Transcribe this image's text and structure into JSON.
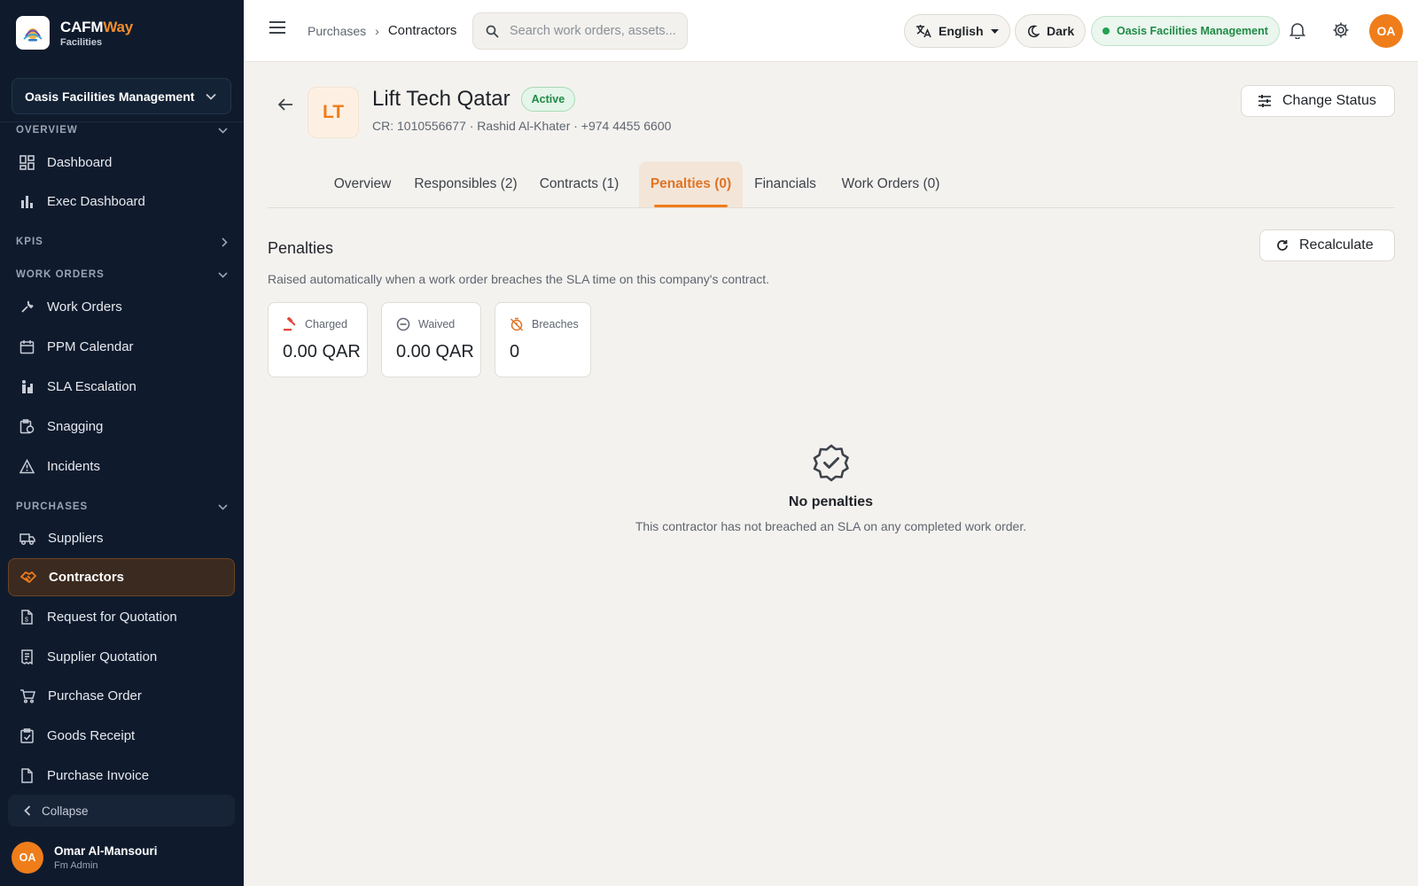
{
  "brand": {
    "name_primary": "CAFM",
    "name_accent": "Way",
    "subtitle": "Facilities",
    "accent_color": "#f08c2e"
  },
  "sidebar": {
    "org_selector": {
      "value": "Oasis Facilities Management"
    },
    "sections": {
      "overview": "OVERVIEW",
      "kpis": "KPIS",
      "work_orders": "WORK ORDERS",
      "purchases": "PURCHASES"
    },
    "items": {
      "dashboard": "Dashboard",
      "exec_dashboard": "Exec Dashboard",
      "work_orders": "Work Orders",
      "ppm_calendar": "PPM Calendar",
      "sla_escalation": "SLA Escalation",
      "snagging": "Snagging",
      "incidents": "Incidents",
      "suppliers": "Suppliers",
      "contractors": "Contractors",
      "rfq": "Request for Quotation",
      "supplier_quotation": "Supplier Quotation",
      "purchase_order": "Purchase Order",
      "goods_receipt": "Goods Receipt",
      "purchase_invoice": "Purchase Invoice"
    },
    "active_item": "Contractors",
    "collapse_label": "Collapse",
    "user": {
      "initials": "OA",
      "name": "Omar Al-Mansouri",
      "role": "Fm Admin"
    }
  },
  "topbar": {
    "breadcrumb": {
      "parent": "Purchases",
      "separator": "›",
      "current": "Contractors"
    },
    "search": {
      "placeholder": "Search work orders, assets..."
    },
    "language": "English",
    "theme_toggle": "Dark",
    "org_badge": "Oasis Facilities Management",
    "avatar_initials": "OA",
    "status_color": "#22a150"
  },
  "contractor": {
    "initials": "LT",
    "name": "Lift Tech Qatar",
    "status": "Active",
    "details": "CR: 1010556677 · Rashid Al-Khater · +974 4455 6600",
    "change_status_label": "Change Status"
  },
  "tabs": [
    {
      "label": "Overview"
    },
    {
      "label": "Responsibles (2)"
    },
    {
      "label": "Contracts (1)"
    },
    {
      "label": "Penalties (0)"
    },
    {
      "label": "Financials"
    },
    {
      "label": "Work Orders (0)"
    }
  ],
  "active_tab": "Penalties (0)",
  "penalties": {
    "title": "Penalties",
    "description": "Raised automatically when a work order breaches the SLA time on this company's contract.",
    "recalculate_label": "Recalculate",
    "stats": [
      {
        "label": "Charged",
        "value": "0.00 QAR",
        "icon": "gavel-icon"
      },
      {
        "label": "Waived",
        "value": "0.00 QAR",
        "icon": "minus-circle-icon"
      },
      {
        "label": "Breaches",
        "value": "0",
        "icon": "timer-off-icon"
      }
    ],
    "empty": {
      "icon": "verified-badge-icon",
      "title": "No penalties",
      "description": "This contractor has not breached an SLA on any completed work order."
    }
  }
}
